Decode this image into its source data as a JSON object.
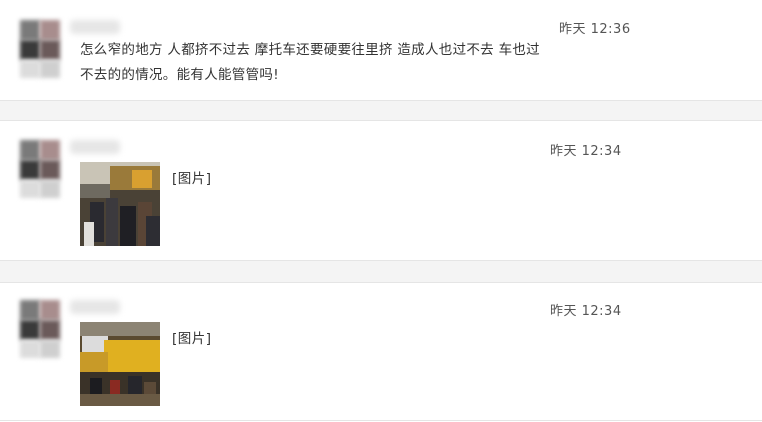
{
  "comments": [
    {
      "time": "昨天 12:36",
      "text_line1": "怎么窄的地方 人都挤不过去 摩托车还要硬要往里挤 造成人也过不去 车也过",
      "text_line2": "不去的的情况。能有人能管管吗!"
    },
    {
      "time": "昨天 12:34",
      "image_label": "[图片]"
    },
    {
      "time": "昨天 12:34",
      "image_label": "[图片]"
    }
  ]
}
